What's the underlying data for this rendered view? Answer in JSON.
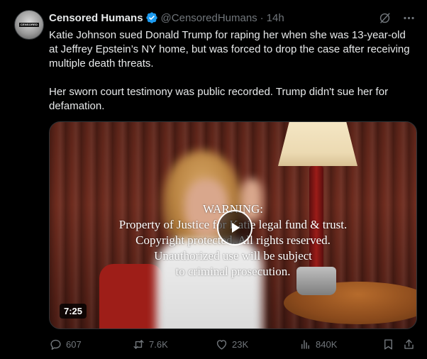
{
  "tweet": {
    "author_name": "Censored Humans",
    "handle": "@CensoredHumans",
    "separator": "·",
    "time": "14h",
    "avatar_text": "CENSORED",
    "paragraphs": [
      "Katie Johnson sued Donald Trump for raping her when she was 13-year-old at Jeffrey Epstein’s NY home, but was forced to drop the case after receiving multiple death threats.",
      "Her sworn court testimony was public recorded. Trump didn't sue her for defamation."
    ]
  },
  "media": {
    "overlay_lines": [
      "WARNING:",
      "Property of Justice for Katie legal fund & trust.",
      "Copyright protected. All rights reserved.",
      "Unauthorized use will be subject",
      "to criminal prosecution."
    ],
    "duration": "7:25"
  },
  "actions": {
    "replies": "607",
    "reposts": "7.6K",
    "likes": "23K",
    "views": "840K"
  },
  "colors": {
    "background": "#000000",
    "text": "#e7e9ea",
    "muted": "#71767b",
    "verified": "#1d9bf0"
  },
  "icons": [
    "verified-badge-icon",
    "grok-icon",
    "more-icon",
    "play-icon",
    "reply-icon",
    "repost-icon",
    "like-icon",
    "views-icon",
    "bookmark-icon",
    "share-icon"
  ]
}
